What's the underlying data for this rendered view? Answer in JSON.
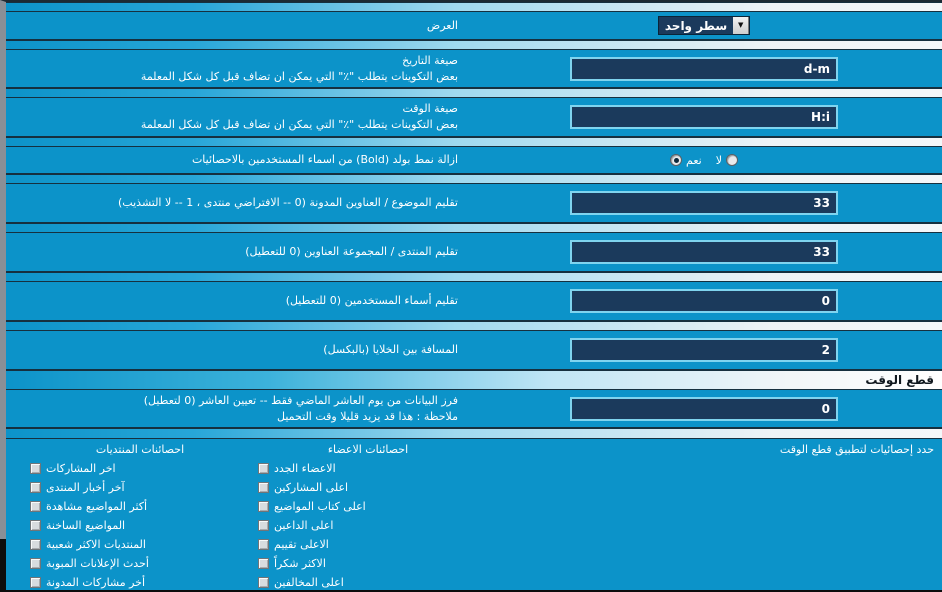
{
  "rows": {
    "display": {
      "label": "العرض",
      "select": {
        "value": "سطر واحد",
        "arrow": "▼"
      }
    },
    "date_format": {
      "label": "صيغة التاريخ",
      "sub": "بعض التكوينات يتطلب  \"٪\"  التي يمكن ان تضاف قبل كل شكل المعلمة",
      "value": "d-m"
    },
    "time_format": {
      "label": "صيغة الوقت",
      "sub": "بعض التكوينات يتطلب  \"٪\"  التي يمكن ان تضاف قبل كل شكل المعلمة",
      "value": "H:i"
    },
    "remove_bold": {
      "label": "ازالة نمط بولد (Bold) من اسماء المستخدمين بالاحصائيات",
      "yes_label": "نعم",
      "no_label": "لا",
      "selected": "yes"
    },
    "trim_topic": {
      "label": "تقليم الموضوع / العناوين المدونة (0 -- الافتراضي منتدى ، 1 -- لا التشذيب)",
      "value": "33"
    },
    "trim_forum": {
      "label": "تقليم المنتدى / المجموعة العناوين (0 للتعطيل)",
      "value": "33"
    },
    "trim_usernames": {
      "label": "تقليم أسماء المستخدمين (0 للتعطيل)",
      "value": "0"
    },
    "cell_spacing": {
      "label": "المسافة بين الخلايا (بالبكسل)",
      "value": "2"
    },
    "timecut_header": {
      "label": "قطع الوقت"
    },
    "timecut_sort": {
      "label": "فرز البيانات من يوم العاشر الماضي فقط -- تعيين العاشر  (0 لتعطيل)",
      "sub": "ملاحظة : هذا قد يزيد قليلا وقت التحميل",
      "value": "0"
    },
    "timecut_apply": {
      "label": "حدد إحصائيات لتطبيق قطع الوقت"
    }
  },
  "columns": [
    {
      "title": "احصائنات المنتديات",
      "items": [
        {
          "label": "اخر المشاركات",
          "checked": false
        },
        {
          "label": "آخر أخبار المنتدى",
          "checked": false
        },
        {
          "label": "أكثر المواضيع مشاهدة",
          "checked": false
        },
        {
          "label": "المواضيع الساخنة",
          "checked": false
        },
        {
          "label": "المنتديات الاكثر شعبية",
          "checked": false
        },
        {
          "label": "أحدث الإعلانات المبوبة",
          "checked": false
        },
        {
          "label": "أخر مشاركات المدونة",
          "checked": false
        }
      ]
    },
    {
      "title": "احصائنات الاعضاء",
      "items": [
        {
          "label": "الاعضاء الجدد",
          "checked": false
        },
        {
          "label": "اعلى المشاركين",
          "checked": false
        },
        {
          "label": "اعلى كتاب المواضيع",
          "checked": false
        },
        {
          "label": "اعلى الداعين",
          "checked": false
        },
        {
          "label": "الاعلى تقييم",
          "checked": false
        },
        {
          "label": "الاكثر شكراً",
          "checked": false
        },
        {
          "label": "اعلى المخالفين",
          "checked": false
        }
      ]
    }
  ]
}
